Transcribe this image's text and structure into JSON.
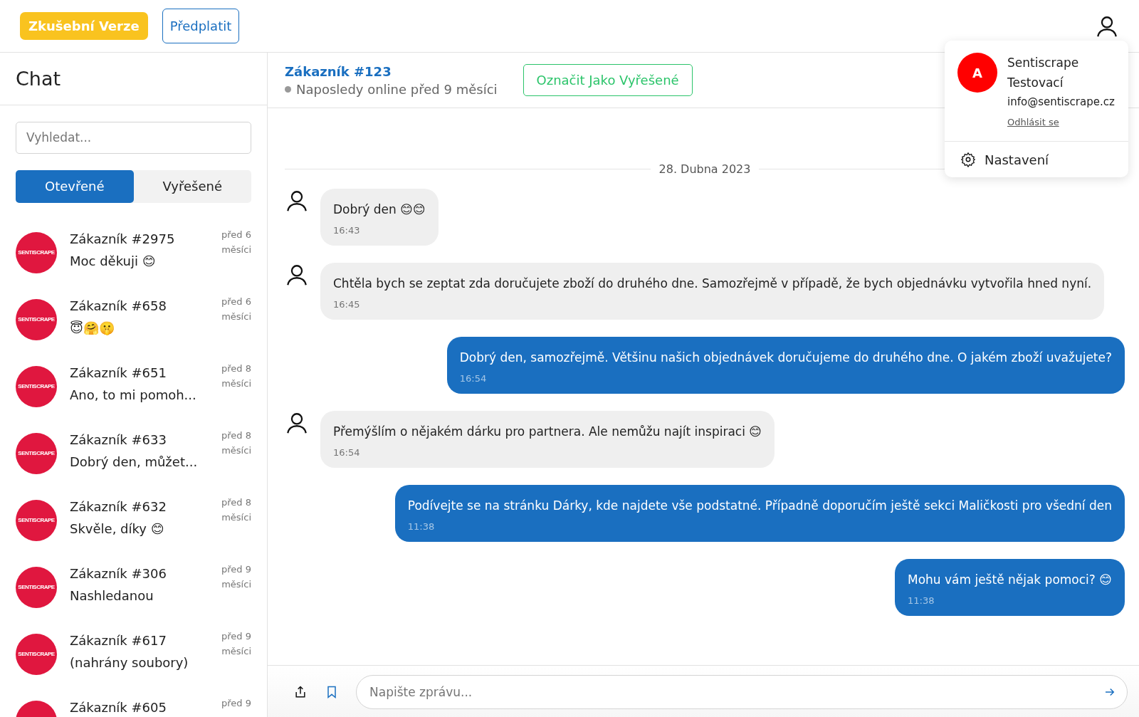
{
  "topbar": {
    "trial_badge": "Zkušební Verze",
    "subscribe_button": "Předplatit"
  },
  "sidebar": {
    "title": "Chat",
    "search": {
      "placeholder": "Vyhledat..."
    },
    "tabs": [
      {
        "label": "Otevřené",
        "selected": true
      },
      {
        "label": "Vyřešené",
        "selected": false
      }
    ],
    "conversations": [
      {
        "avatar_text": "SENTISCRAPE",
        "name": "Zákazník #2975",
        "preview": "Moc děkuji 😊",
        "time": "před 6 měsíci"
      },
      {
        "avatar_text": "SENTISCRAPE",
        "name": "Zákazník #658",
        "preview": "😇🤗🤫",
        "time": "před 6 měsíci"
      },
      {
        "avatar_text": "SENTISCRAPE",
        "name": "Zákazník #651",
        "preview": "Ano, to mi pomoh...",
        "time": "před 8 měsíci"
      },
      {
        "avatar_text": "SENTISCRAPE",
        "name": "Zákazník #633",
        "preview": "Dobrý den, můžet...",
        "time": "před 8 měsíci"
      },
      {
        "avatar_text": "SENTISCRAPE",
        "name": "Zákazník #632",
        "preview": "Skvěle, díky 😊",
        "time": "před 8 měsíci"
      },
      {
        "avatar_text": "SENTISCRAPE",
        "name": "Zákazník #306",
        "preview": "Nashledanou",
        "time": "před 9 měsíci"
      },
      {
        "avatar_text": "SENTISCRAPE",
        "name": "Zákazník #617",
        "preview": "(nahrány soubory)",
        "time": "před 9 měsíci"
      },
      {
        "name": "Zákazník #605",
        "time": "před 9"
      }
    ]
  },
  "chat": {
    "customer": "Zákazník #123",
    "last_online": "Naposledy online před 9 měsíci",
    "resolve_button": "Označit Jako Vyřešené",
    "date_divider": "28. Dubna 2023",
    "messages": [
      {
        "kind": "incoming",
        "text": "Dobrý den 😊😊",
        "time": "16:43"
      },
      {
        "kind": "incoming",
        "text": "Chtěla bych se zeptat zda doručujete zboží do druhého dne. Samozřejmě v případě, že bych objednávku vytvořila hned nyní.",
        "time": "16:45"
      },
      {
        "kind": "outgoing",
        "text": "Dobrý den, samozřejmě. Většinu našich objednávek doručujeme do druhého dne. O jakém zboží uvažujete?",
        "time": "16:54"
      },
      {
        "kind": "incoming",
        "text": "Přemýšlím o nějakém dárku pro partnera. Ale nemůžu najít inspiraci 😊",
        "time": "16:54"
      },
      {
        "kind": "outgoing",
        "text": "Podívejte se na stránku Dárky, kde najdete vše podstatné. Případně doporučím ještě sekci Maličkosti pro všední den",
        "time": "11:38"
      },
      {
        "kind": "outgoing",
        "text": "Mohu vám ještě nějak pomoci? 😊",
        "time": "11:38"
      }
    ],
    "composer": {
      "placeholder": "Napište zprávu..."
    }
  },
  "user_menu": {
    "avatar_letter": "A",
    "name": "Sentiscrape Testovací",
    "email": "info@sentiscrape.cz",
    "logout_link": "Odhlásit se",
    "settings_item": "Nastavení"
  }
}
